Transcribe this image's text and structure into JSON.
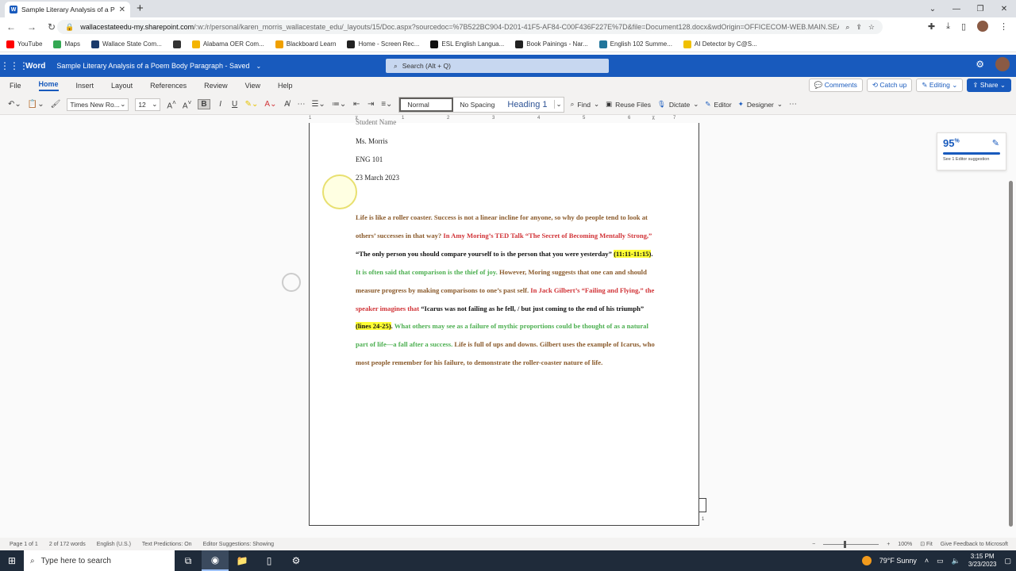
{
  "browser": {
    "tab_title": "Sample Literary Analysis of a Po",
    "url_host": "wallacestateedu-my.sharepoint.com",
    "url_path": "/:w:/r/personal/karen_morris_wallacestate_edu/_layouts/15/Doc.aspx?sourcedoc=%7B522BC904-D201-41F5-AF84-C00F436F227E%7D&file=Document128.docx&wdOrigin=OFFICECOM-WEB.MAIN.SEA...",
    "bookmarks": [
      {
        "label": "YouTube",
        "color": "#ff0000"
      },
      {
        "label": "Maps",
        "color": "#34a853"
      },
      {
        "label": "Wallace State Com...",
        "color": "#1a3a6b"
      },
      {
        "label": "",
        "color": "#333333"
      },
      {
        "label": "Alabama OER Com...",
        "color": "#f4b400"
      },
      {
        "label": "Blackboard Learn",
        "color": "#f0a000"
      },
      {
        "label": "Home - Screen Rec...",
        "color": "#222222"
      },
      {
        "label": "ESL English Langua...",
        "color": "#111111"
      },
      {
        "label": "Book Painings - Nar...",
        "color": "#222222"
      },
      {
        "label": "English 102 Summe...",
        "color": "#21759b"
      },
      {
        "label": "AI Detector by C@S...",
        "color": "#f0c000"
      }
    ]
  },
  "word": {
    "app_name": "Word",
    "doc_title": "Sample Literary Analysis of a Poem Body Paragraph  -  Saved",
    "search_placeholder": "Search (Alt + Q)",
    "menu": [
      "File",
      "Home",
      "Insert",
      "Layout",
      "References",
      "Review",
      "View",
      "Help"
    ],
    "active_menu": "Home",
    "comments_label": "Comments",
    "catchup_label": "Catch up",
    "editing_label": "Editing",
    "share_label": "Share",
    "font_name": "Times New Ro...",
    "font_size": "12",
    "styles": [
      "Normal",
      "No Spacing",
      "Heading 1"
    ],
    "find_label": "Find",
    "reuse_label": "Reuse Files",
    "dictate_label": "Dictate",
    "editor_label": "Editor",
    "designer_label": "Designer"
  },
  "document": {
    "header_lines": [
      "Student Name",
      "Ms. Morris",
      "ENG 101",
      "23 March 2023"
    ],
    "paragraph": [
      {
        "text": "Life is like a roller coaster. Success is not a linear incline for anyone, so why do people tend to look at others’ successes in that way? ",
        "color": "brown"
      },
      {
        "text": "In Amy Moring’s TED Talk “The Secret of Becoming Mentally Strong,” ",
        "color": "red"
      },
      {
        "text": "“The only person you should compare yourself to is the person that you were yesterday” ",
        "color": "black"
      },
      {
        "text": "(11:11-11:15)",
        "color": "highlight"
      },
      {
        "text": ". ",
        "color": "black"
      },
      {
        "text": "It is often said that comparison is the thief of joy. ",
        "color": "green"
      },
      {
        "text": "However, Moring suggests that one can and should measure progress by making comparisons to one’s past self. ",
        "color": "brown"
      },
      {
        "text": "In Jack Gilbert’s “Failing and Flying,” the speaker imagines that ",
        "color": "red"
      },
      {
        "text": "“Icarus was not failing as he fell, / but just coming to the end of his triumph” ",
        "color": "black"
      },
      {
        "text": "(lines 24-25)",
        "color": "highlight"
      },
      {
        "text": ". ",
        "color": "black"
      },
      {
        "text": "What others may see as a failure of mythic proportions could be thought of as a natural part of life—a fall after a success. ",
        "color": "green"
      },
      {
        "text": "Life is full of ups and downs. Gilbert uses the example of Icarus, who most people remember for his failure, to demonstrate the roller-coaster nature of life.",
        "color": "brown"
      }
    ],
    "page_number": "1"
  },
  "editor_card": {
    "score": "95",
    "score_unit": "%",
    "suggestion": "See 1 Editor suggestion"
  },
  "status": {
    "page": "Page 1 of 1",
    "words": "2 of 172 words",
    "language": "English (U.S.)",
    "predictions": "Text Predictions: On",
    "editor": "Editor Suggestions: Showing",
    "zoom": "100%",
    "fit": "Fit",
    "feedback": "Give Feedback to Microsoft"
  },
  "taskbar": {
    "search_placeholder": "Type here to search",
    "weather": "79°F  Sunny",
    "time": "3:15 PM",
    "date": "3/23/2023"
  },
  "colors": {
    "word_blue": "#185abd",
    "brown": "#8a5a2b",
    "red": "#d13438",
    "green": "#4caf50",
    "highlight": "#ffff33"
  }
}
